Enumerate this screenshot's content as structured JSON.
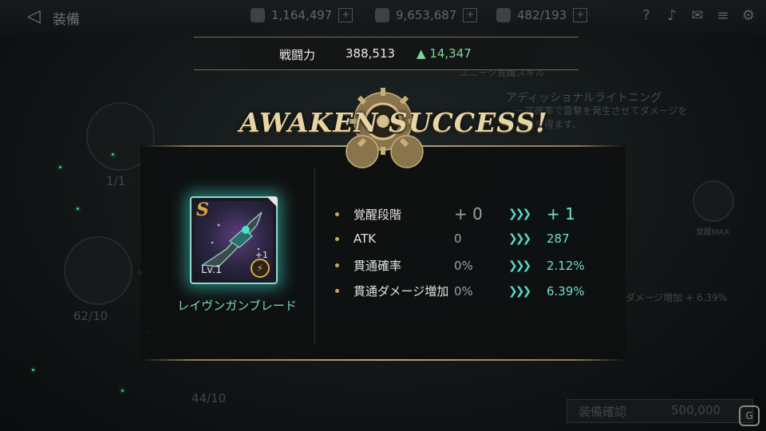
{
  "header": {
    "title": "装備",
    "resources": [
      {
        "icon": "gold-icon",
        "value": "1,164,497"
      },
      {
        "icon": "crystal-icon",
        "value": "9,653,687"
      },
      {
        "icon": "stamina-icon",
        "value": "482/193"
      }
    ],
    "icons": [
      "help-icon",
      "notification-bell-icon",
      "mail-icon",
      "chat-icon",
      "settings-gear-icon"
    ]
  },
  "background": {
    "slot_counts": [
      "1/1",
      "62/10",
      "44/10"
    ],
    "skill_label": "ユニーク覚醒スキル",
    "skill_name": "アディッショナルライトニング",
    "skill_desc_1": "…一定確率で雷撃を発生させてダメージを",
    "skill_desc_2": "…効果を得ます。",
    "max_label": "覚醒MAX",
    "effect_text": "…ダメージ増加 + 6.39%",
    "confirm_button": "装備確認",
    "cost": "500,000"
  },
  "power": {
    "label": "戦闘力",
    "value": "388,513",
    "increase": "14,347"
  },
  "result": {
    "title": "AWAKEN SUCCESS!",
    "item": {
      "name": "レイヴンガンブレード",
      "level": "Lv.1",
      "rank": "S",
      "awaken_plus": "+1"
    },
    "stats": [
      {
        "name": "覚醒段階",
        "old": "+ 0",
        "new": "+ 1"
      },
      {
        "name": "ATK",
        "old": "0",
        "new": "287"
      },
      {
        "name": "貫通確率",
        "old": "0%",
        "new": "2.12%"
      },
      {
        "name": "貫通ダメージ増加",
        "old": "0%",
        "new": "6.39%"
      }
    ]
  },
  "colors": {
    "accent_teal": "#6fdfd0",
    "gold": "#c9a85a",
    "increase_green": "#7ed59a"
  }
}
